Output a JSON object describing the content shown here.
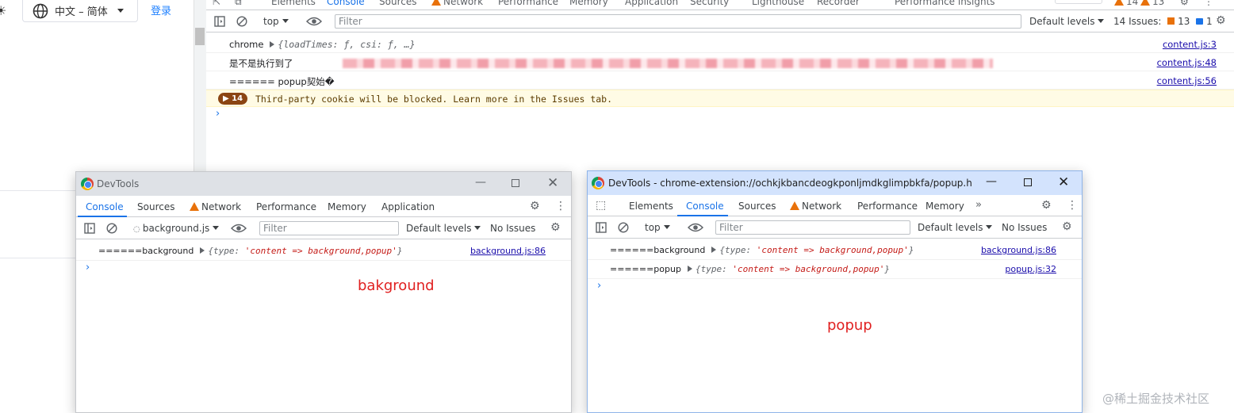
{
  "page": {
    "lang_label": "中文 – 简体",
    "login_label": "登录",
    "watermark": "@稀土掘金技术社区"
  },
  "main_devtools": {
    "tabs": [
      "Elements",
      "Console",
      "Sources",
      "Network",
      "Performance",
      "Memory",
      "Application",
      "Security",
      "Lighthouse",
      "Recorder",
      "Performance insights"
    ],
    "active_tab": "Console",
    "top_counts": {
      "warnings": "14",
      "errors": "13"
    },
    "context": "top",
    "filter_placeholder": "Filter",
    "default_levels": "Default levels",
    "issues_label": "14 Issues:",
    "issues_warn": "13",
    "issues_info": "1",
    "logs": [
      {
        "text": "chrome",
        "obj": "{loadTimes: ƒ, csi: ƒ, …}",
        "source": "content.js:3"
      },
      {
        "text": "是不是执行到了",
        "source": "content.js:48"
      },
      {
        "text": "====== popup契始�",
        "source": "content.js:56"
      }
    ],
    "issue_badge": "14",
    "issue_message": "Third-party cookie will be blocked. Learn more in the Issues tab."
  },
  "bg_window": {
    "title": "DevTools",
    "tabs": [
      "Console",
      "Sources",
      "Network",
      "Performance",
      "Memory",
      "Application"
    ],
    "active_tab": "Console",
    "context": "background.js",
    "filter_placeholder": "Filter",
    "default_levels": "Default levels",
    "issues_label": "No Issues",
    "log": {
      "text": "======background",
      "obj_key": "type:",
      "obj_val": "'content => background,popup'",
      "source": "background.js:86"
    },
    "caption": "bakground"
  },
  "popup_window": {
    "title": "DevTools - chrome-extension://ochkjkbancdeogkponljmdkglimpbkfa/popup.h...",
    "tabs": [
      "Elements",
      "Console",
      "Sources",
      "Network",
      "Performance",
      "Memory"
    ],
    "active_tab": "Console",
    "context": "top",
    "filter_placeholder": "Filter",
    "default_levels": "Default levels",
    "issues_label": "No Issues",
    "logs": [
      {
        "text": "======background",
        "obj_key": "type:",
        "obj_val": "'content => background,popup'",
        "source": "background.js:86"
      },
      {
        "text": "======popup",
        "obj_key": "type:",
        "obj_val": "'content => background,popup'",
        "source": "popup.js:32"
      }
    ],
    "caption": "popup"
  }
}
